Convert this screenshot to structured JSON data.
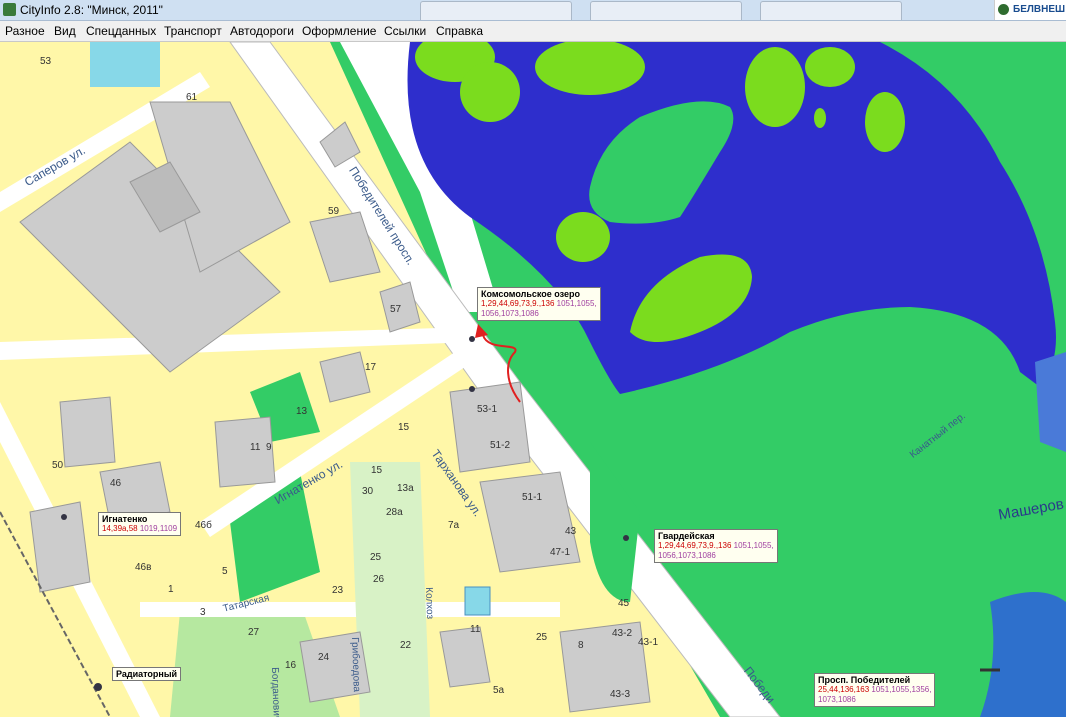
{
  "window": {
    "title": "CityInfo 2.8: \"Минск, 2011\"",
    "brand": "БЕЛВНЕШ"
  },
  "menu": [
    "Разное",
    "Вид",
    "Спецданных",
    "Транспорт",
    "Автодороги",
    "Оформление",
    "Ссылки",
    "Справка"
  ],
  "streets": {
    "pobediteley": "Победителей просп.",
    "pobediteley2": "Победи",
    "saperov": "Саперов ул.",
    "ignatenko": "Игнатенко ул.",
    "tarkhanova": "Тарханова ул.",
    "tatarskaya": "Татарская",
    "kanatny": "Канатный пер.",
    "masherova": "Машеров",
    "griboedova": "Грибоедова",
    "bogdanovicha": "Богдановича",
    "kolhoz": "Колхоз"
  },
  "stops": [
    {
      "name": "Комсомольское озеро",
      "routes1": "1,29,44,69,73,9.,136",
      "routes2": "1051,1055,",
      "routes3": "1056,1073,1086"
    },
    {
      "name": "Игнатенко",
      "routes1": "14,39а,58",
      "routes2": "1019,1109",
      "routes3": ""
    },
    {
      "name": "Гвардейская",
      "routes1": "1,29,44,69,73,9.,136",
      "routes2": "1051,1055,",
      "routes3": "1056,1073,1086"
    },
    {
      "name": "Радиаторный",
      "routes1": "",
      "routes2": "",
      "routes3": ""
    },
    {
      "name": "Просп. Победителей",
      "routes1": "25,44,136,163",
      "routes2": "1051,1055,1356,",
      "routes3": "1073,1086"
    }
  ],
  "house_numbers": [
    "53",
    "61",
    "59",
    "57",
    "17",
    "13",
    "11",
    "9",
    "50",
    "46",
    "46в",
    "46б",
    "5",
    "53-1",
    "51-2",
    "51-1",
    "43",
    "47-1",
    "15",
    "13а",
    "7а",
    "28а",
    "30",
    "15",
    "25",
    "26",
    "23",
    "22",
    "24",
    "3",
    "1",
    "27",
    "16",
    "5а",
    "11",
    "43-2",
    "43-1",
    "45",
    "43-3",
    "25",
    "8"
  ],
  "colors": {
    "water": "#2e2ecc",
    "green": "#7bdc1e",
    "park": "#33cc66",
    "residential": "#fff7a8",
    "road": "#ffffff",
    "building": "#cccccc"
  }
}
